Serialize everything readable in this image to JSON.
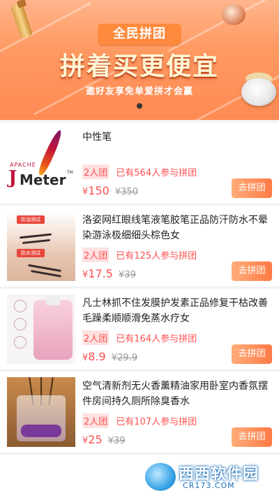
{
  "banner": {
    "title": "全民拼团",
    "headline": "拼着买更便宜",
    "subline": "邀好友享免单爱拼才会赢"
  },
  "colors": {
    "accent": "#ff4f4f",
    "button": "#ff7a45"
  },
  "items": [
    {
      "name": "中性笔",
      "image_icon": "jmeter-logo",
      "logo_text_top": "APACHE",
      "logo_text_j": "J",
      "logo_text_main": "Meter",
      "logo_tm": "TM",
      "tag": "2人团",
      "joined": "已有564人参与拼团",
      "currency": "¥",
      "price": "150",
      "orig_price": "¥350",
      "button": "去拼团"
    },
    {
      "name": "洛姿网红眼线笔液笔胶笔正品防汗防水不晕染游泳极细细头棕色女",
      "image_icon": "eyeliner-test-photo",
      "image_label_1": "防油测试",
      "image_label_2": "防水测试",
      "tag": "2人团",
      "joined": "已有125人参与拼团",
      "currency": "¥",
      "price": "17.5",
      "orig_price": "¥39",
      "button": "去拼团"
    },
    {
      "name": "凡士林抓不住发膜护发素正品修复干枯改善毛躁柔顺顺滑免蒸水疗女",
      "image_icon": "hair-mask-bag",
      "tag": "2人团",
      "joined": "已有164人参与拼团",
      "currency": "¥",
      "price": "8.9",
      "orig_price": "¥29.9",
      "button": "去拼团"
    },
    {
      "name": "空气清新剂无火香薰精油家用卧室内香氛摆件房间持久厕所除臭香水",
      "image_icon": "aroma-diffuser-bottle",
      "tag": "2人团",
      "joined": "已有107人参与拼团",
      "currency": "¥",
      "price": "25",
      "orig_price": "¥39",
      "button": "去拼团"
    }
  ],
  "watermark": {
    "brand": "西西软件园",
    "domain": "CR173.COM"
  }
}
